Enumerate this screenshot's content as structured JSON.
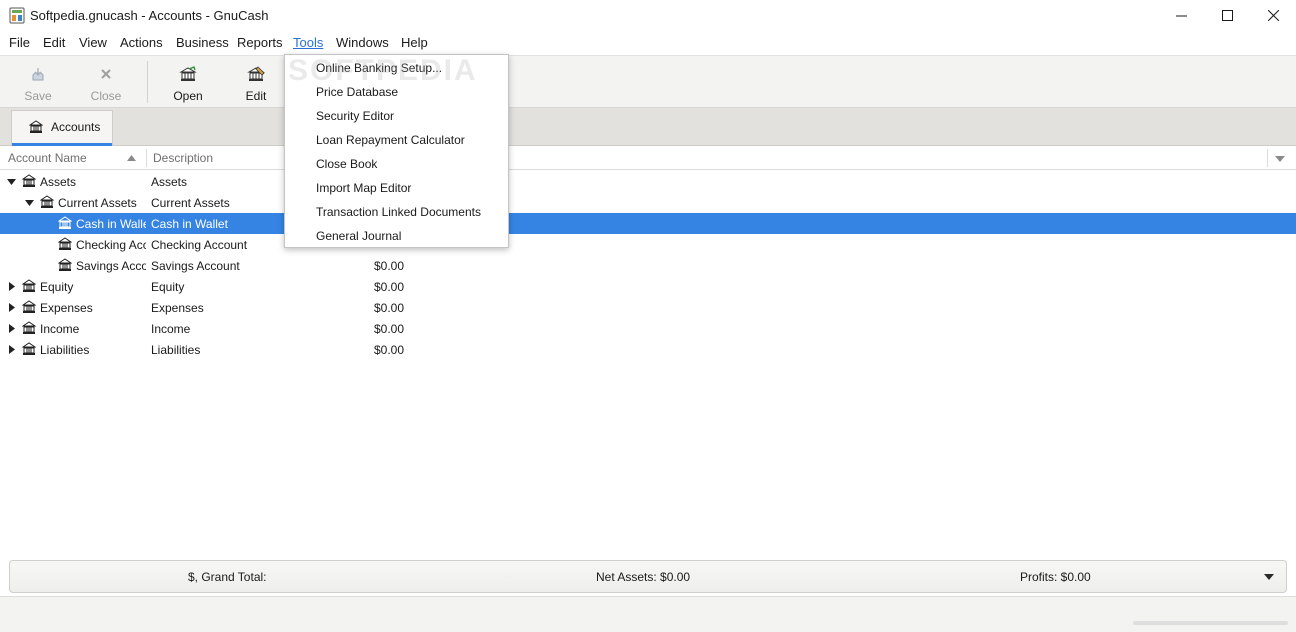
{
  "window": {
    "title": "Softpedia.gnucash - Accounts - GnuCash"
  },
  "menubar": {
    "items": [
      {
        "label": "File"
      },
      {
        "label": "Edit"
      },
      {
        "label": "View"
      },
      {
        "label": "Actions"
      },
      {
        "label": "Business"
      },
      {
        "label": "Reports"
      },
      {
        "label": "Tools",
        "active": true
      },
      {
        "label": "Windows"
      },
      {
        "label": "Help"
      }
    ]
  },
  "toolbar": {
    "save_label": "Save",
    "close_label": "Close",
    "open_label": "Open",
    "edit_label": "Edit"
  },
  "tabs": [
    {
      "label": "Accounts",
      "icon": "bank-icon"
    }
  ],
  "columns": {
    "account_name": "Account Name",
    "description": "Description"
  },
  "accounts": [
    {
      "name": "Assets",
      "description": "Assets",
      "total": "",
      "level": 0,
      "expander": "expanded",
      "selected": false
    },
    {
      "name": "Current Assets",
      "description": "Current Assets",
      "total": "",
      "level": 1,
      "expander": "expanded",
      "selected": false
    },
    {
      "name": "Cash in Wallet",
      "description": "Cash in Wallet",
      "total": "",
      "level": 2,
      "expander": "none",
      "selected": true
    },
    {
      "name": "Checking Account",
      "description": "Checking Account",
      "total": "",
      "level": 2,
      "expander": "none",
      "selected": false
    },
    {
      "name": "Savings Account",
      "description": "Savings Account",
      "total": "$0.00",
      "level": 2,
      "expander": "none",
      "selected": false
    },
    {
      "name": "Equity",
      "description": "Equity",
      "total": "$0.00",
      "level": 0,
      "expander": "collapsed",
      "selected": false
    },
    {
      "name": "Expenses",
      "description": "Expenses",
      "total": "$0.00",
      "level": 0,
      "expander": "collapsed",
      "selected": false
    },
    {
      "name": "Income",
      "description": "Income",
      "total": "$0.00",
      "level": 0,
      "expander": "collapsed",
      "selected": false
    },
    {
      "name": "Liabilities",
      "description": "Liabilities",
      "total": "$0.00",
      "level": 0,
      "expander": "collapsed",
      "selected": false
    }
  ],
  "summary": {
    "grand_total": "$, Grand Total:",
    "net_assets": "Net Assets: $0.00",
    "profits": "Profits: $0.00"
  },
  "tools_menu": {
    "items": [
      "Online Banking Setup...",
      "Price Database",
      "Security Editor",
      "Loan Repayment Calculator",
      "Close Book",
      "Import Map Editor",
      "Transaction Linked Documents",
      "General Journal"
    ]
  },
  "watermark": "SOFTPEDIA",
  "colors": {
    "selection": "#3584e4",
    "menu_active": "#2b6fd6"
  }
}
